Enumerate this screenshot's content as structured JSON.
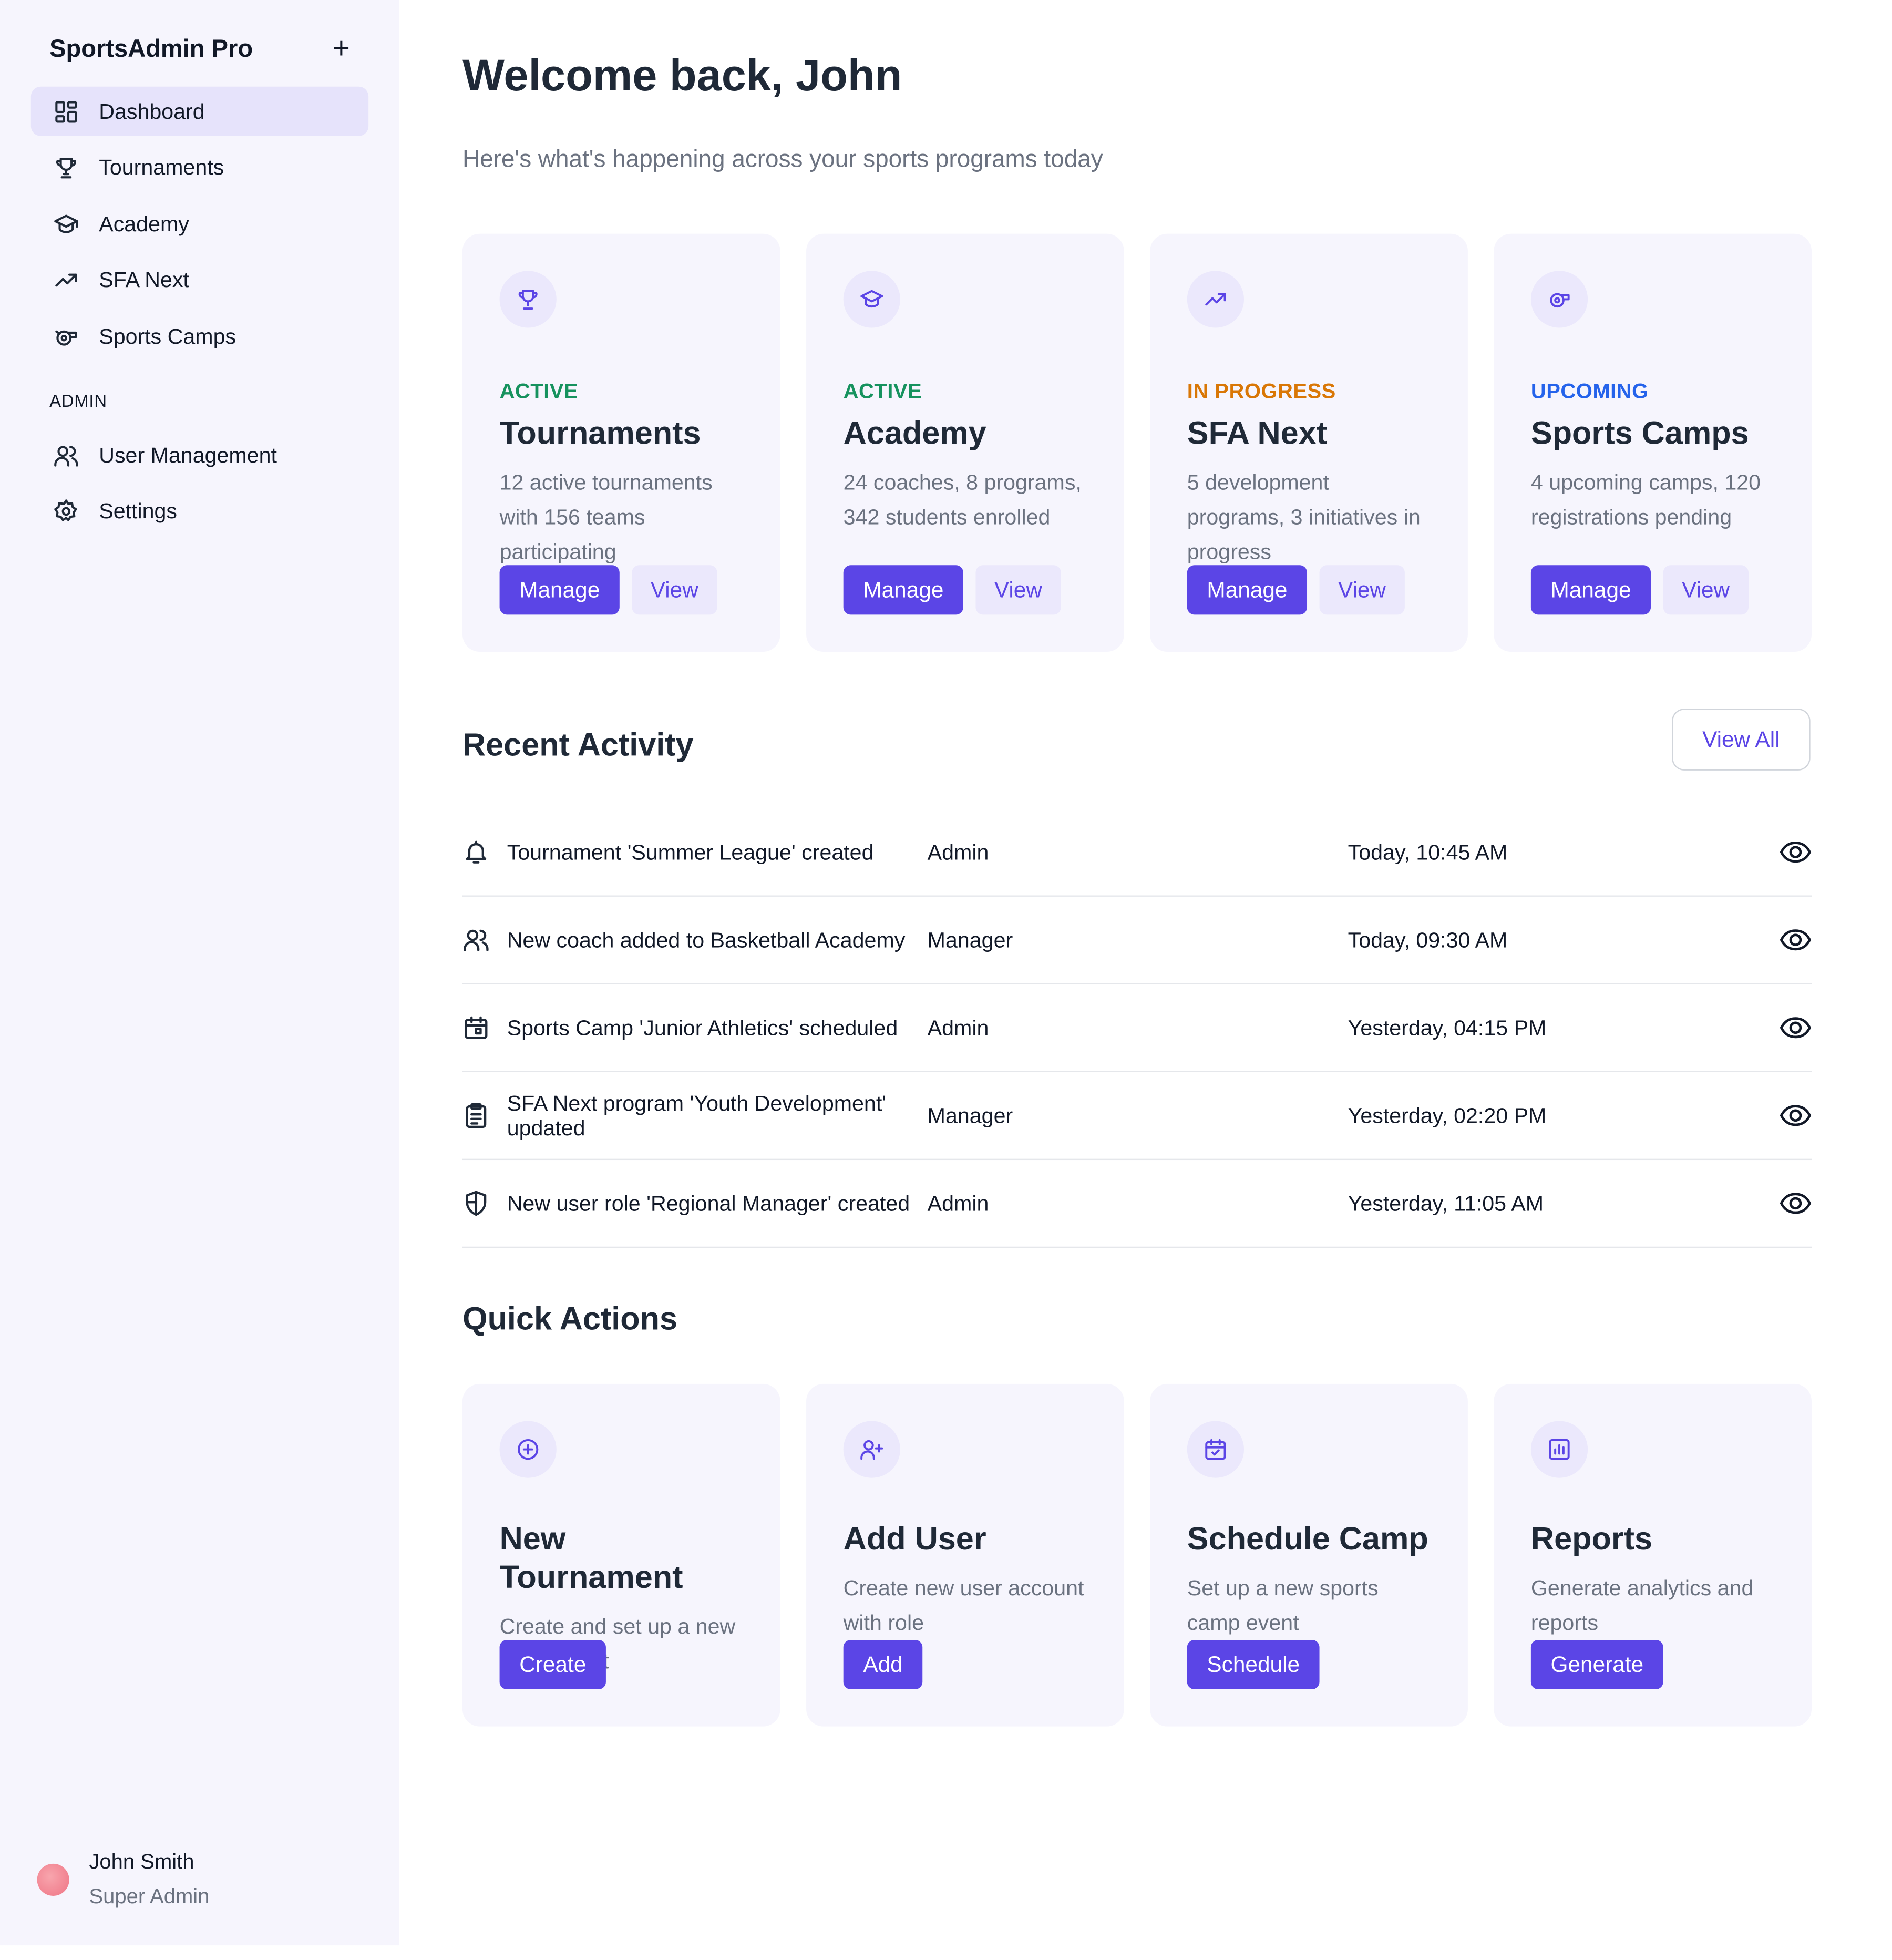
{
  "brand": {
    "name": "SportsAdmin Pro",
    "plus": "+"
  },
  "nav": [
    {
      "label": "Dashboard",
      "icon": "dashboard-icon",
      "active": true
    },
    {
      "label": "Tournaments",
      "icon": "trophy-icon"
    },
    {
      "label": "Academy",
      "icon": "graduation-cap-icon"
    },
    {
      "label": "SFA Next",
      "icon": "trending-up-icon"
    },
    {
      "label": "Sports Camps",
      "icon": "whistle-icon"
    }
  ],
  "admin_section": "ADMIN",
  "admin_nav": [
    {
      "label": "User Management",
      "icon": "users-icon"
    },
    {
      "label": "Settings",
      "icon": "gear-icon"
    }
  ],
  "user": {
    "name": "John Smith",
    "role": "Super Admin"
  },
  "header": {
    "title": "Welcome back, John",
    "subtitle": "Here's what's happening across your sports programs today"
  },
  "programs": [
    {
      "status": "ACTIVE",
      "title": "Tournaments",
      "desc": "12 active tournaments with 156 teams participating",
      "manage": "Manage",
      "view": "View"
    },
    {
      "status": "ACTIVE",
      "title": "Academy",
      "desc": "24 coaches, 8 programs, 342 students enrolled",
      "manage": "Manage",
      "view": "View"
    },
    {
      "status": "IN PROGRESS",
      "title": "SFA Next",
      "desc": "5 development programs, 3 initiatives in progress",
      "manage": "Manage",
      "view": "View"
    },
    {
      "status": "UPCOMING",
      "title": "Sports Camps",
      "desc": "4 upcoming camps, 120 registrations pending",
      "manage": "Manage",
      "view": "View"
    }
  ],
  "recent": {
    "title": "Recent Activity",
    "view_all": "View All",
    "rows": [
      {
        "activity": "Tournament 'Summer League' created",
        "user": "Admin",
        "time": "Today, 10:45 AM",
        "icon": "bell-icon"
      },
      {
        "activity": "New coach added to Basketball Academy",
        "user": "Manager",
        "time": "Today, 09:30 AM",
        "icon": "users-icon"
      },
      {
        "activity": "Sports Camp 'Junior Athletics' scheduled",
        "user": "Admin",
        "time": "Yesterday, 04:15 PM",
        "icon": "calendar-icon"
      },
      {
        "activity": "SFA Next program 'Youth Development' updated",
        "user": "Manager",
        "time": "Yesterday, 02:20 PM",
        "icon": "clipboard-icon"
      },
      {
        "activity": "New user role 'Regional Manager' created",
        "user": "Admin",
        "time": "Yesterday, 11:05 AM",
        "icon": "shield-icon"
      }
    ]
  },
  "quick": {
    "title": "Quick Actions",
    "items": [
      {
        "title": "New Tournament",
        "desc": "Create and set up a new tournament",
        "button": "Create"
      },
      {
        "title": "Add User",
        "desc": "Create new user account with role",
        "button": "Add"
      },
      {
        "title": "Schedule Camp",
        "desc": "Set up a new sports camp event",
        "button": "Schedule"
      },
      {
        "title": "Reports",
        "desc": "Generate analytics and reports",
        "button": "Generate"
      }
    ]
  },
  "colors": {
    "accent": "#5b45e6",
    "active": "#16925e",
    "in_progress": "#d97706",
    "upcoming": "#2563eb"
  }
}
